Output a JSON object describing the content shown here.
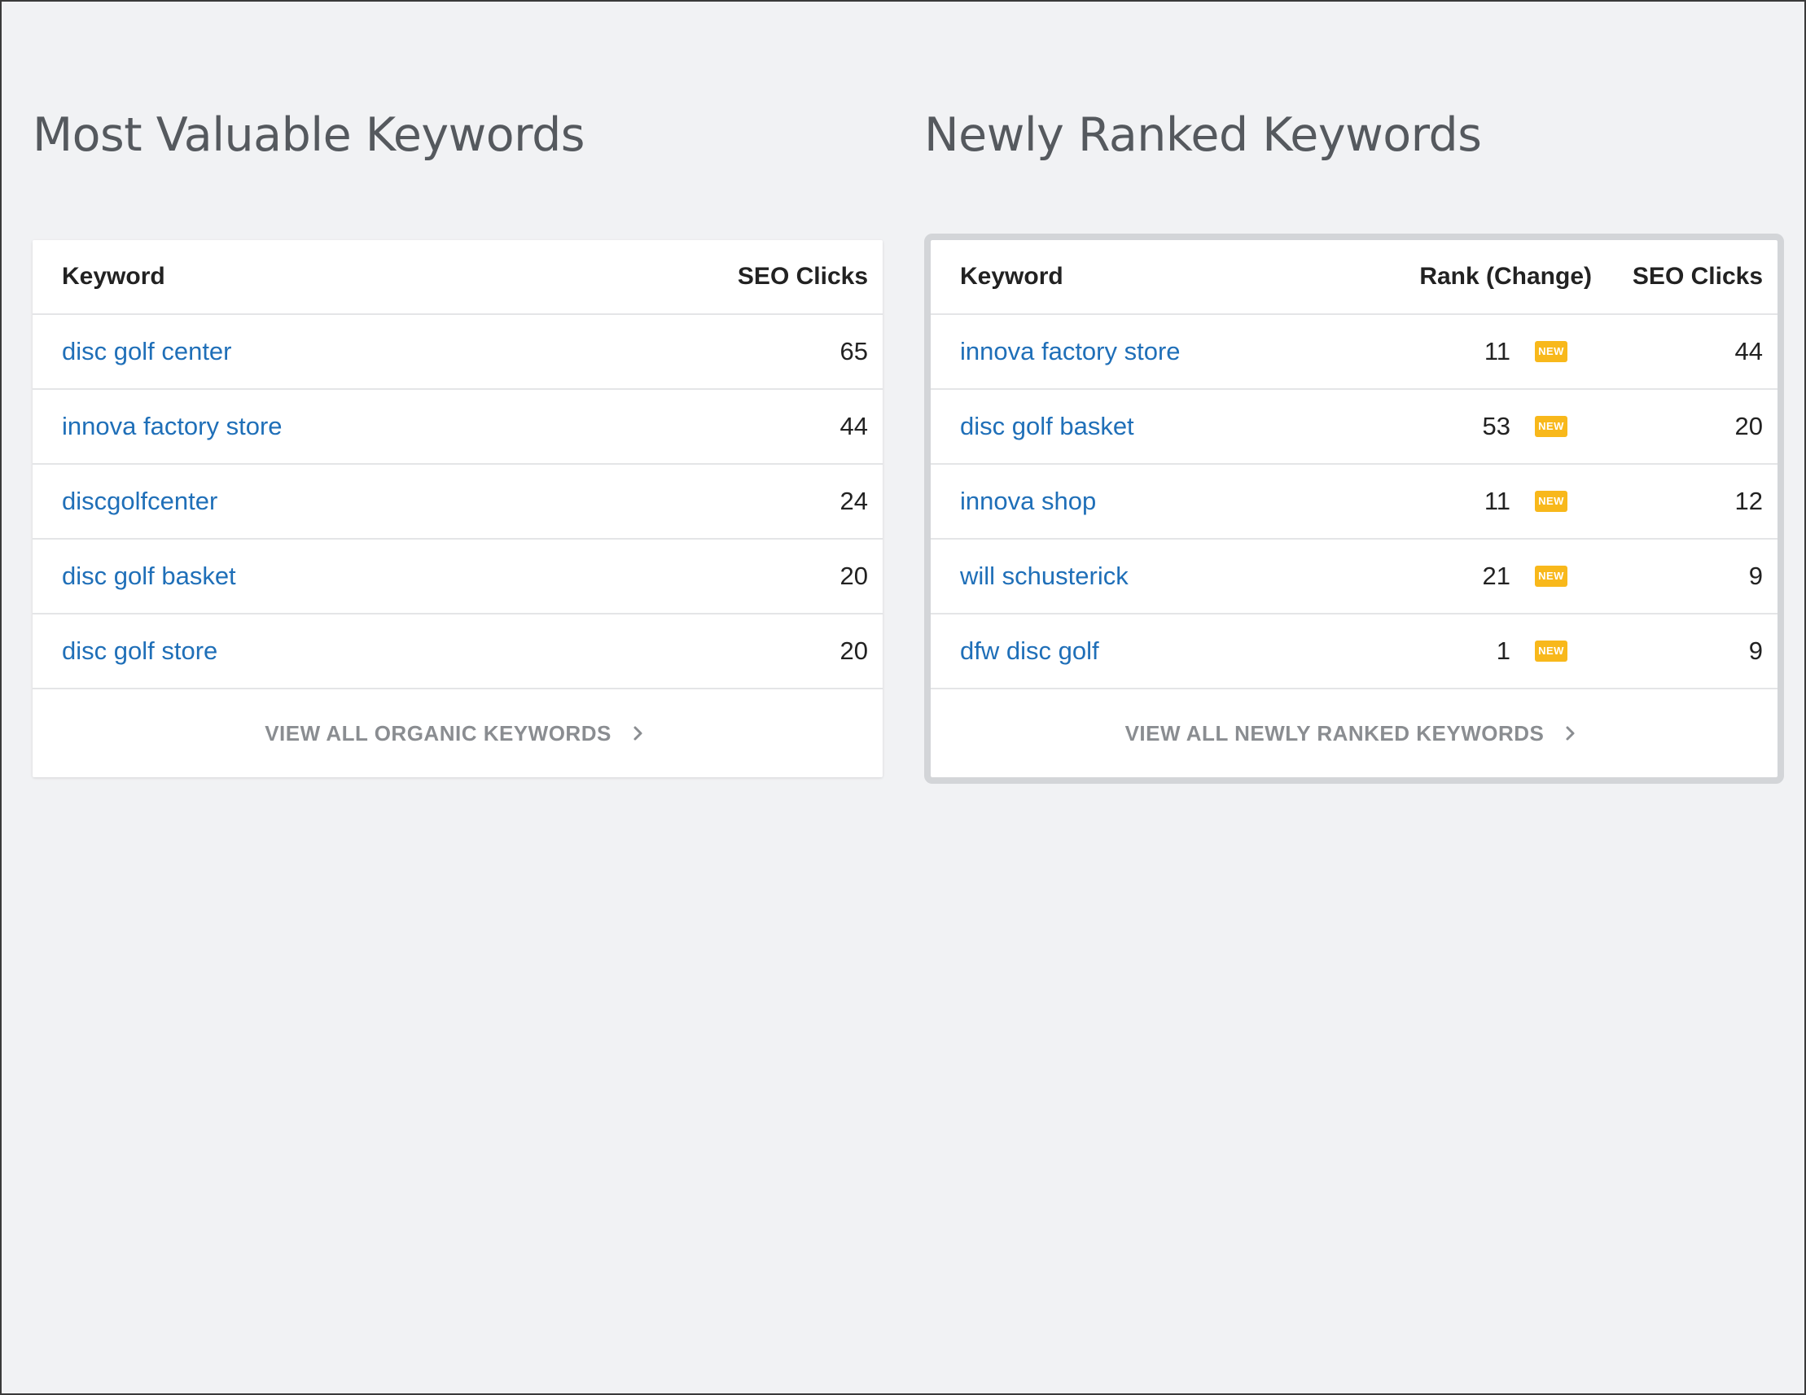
{
  "left": {
    "title": "Most Valuable Keywords",
    "headers": {
      "keyword": "Keyword",
      "clicks": "SEO Clicks"
    },
    "rows": [
      {
        "keyword": "disc golf center",
        "clicks": "65"
      },
      {
        "keyword": "innova factory store",
        "clicks": "44"
      },
      {
        "keyword": "discgolfcenter",
        "clicks": "24"
      },
      {
        "keyword": "disc golf basket",
        "clicks": "20"
      },
      {
        "keyword": "disc golf store",
        "clicks": "20"
      }
    ],
    "footer": "VIEW ALL ORGANIC KEYWORDS"
  },
  "right": {
    "title": "Newly Ranked Keywords",
    "headers": {
      "keyword": "Keyword",
      "rank": "Rank (Change)",
      "clicks": "SEO Clicks"
    },
    "rows": [
      {
        "keyword": "innova factory store",
        "rank": "11",
        "badge": "NEW",
        "clicks": "44"
      },
      {
        "keyword": "disc golf basket",
        "rank": "53",
        "badge": "NEW",
        "clicks": "20"
      },
      {
        "keyword": "innova shop",
        "rank": "11",
        "badge": "NEW",
        "clicks": "12"
      },
      {
        "keyword": "will schusterick",
        "rank": "21",
        "badge": "NEW",
        "clicks": "9"
      },
      {
        "keyword": "dfw disc golf",
        "rank": "1",
        "badge": "NEW",
        "clicks": "9"
      }
    ],
    "footer": "VIEW ALL NEWLY RANKED KEYWORDS"
  },
  "colors": {
    "link": "#1f6fb8",
    "badge": "#f8b81b",
    "background": "#f1f2f4"
  },
  "icons": {
    "footer_arrow": "chevron-right-icon"
  }
}
